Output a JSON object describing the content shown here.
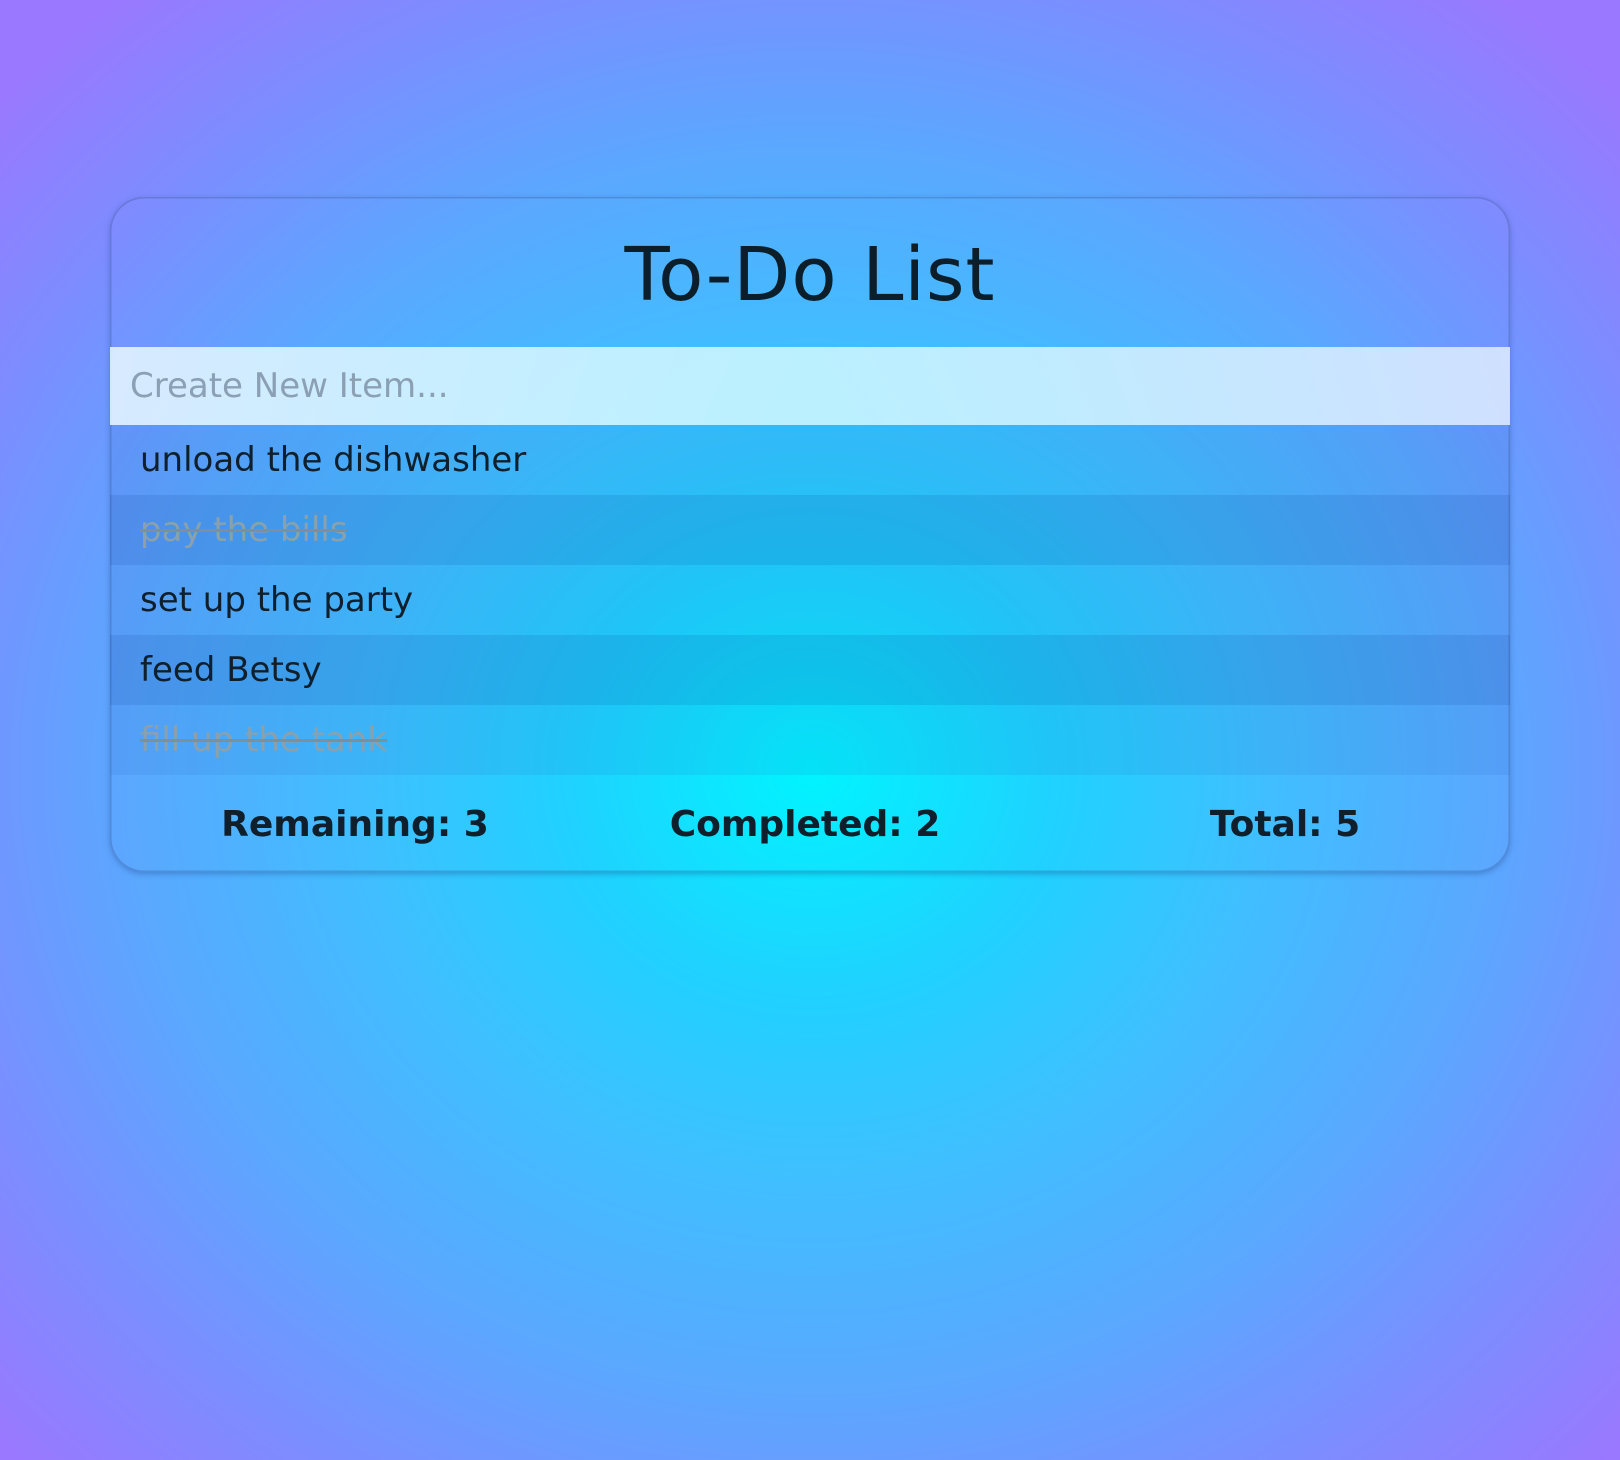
{
  "app": {
    "title": "To-Do List"
  },
  "new_item": {
    "placeholder": "Create New Item...",
    "value": ""
  },
  "items": [
    {
      "label": "unload the dishwasher",
      "completed": false
    },
    {
      "label": "pay the bills",
      "completed": true
    },
    {
      "label": "set up the party",
      "completed": false
    },
    {
      "label": "feed Betsy",
      "completed": false
    },
    {
      "label": "fill up the tank",
      "completed": true
    }
  ],
  "stats": {
    "remaining": "Remaining: 3",
    "completed": "Completed: 2",
    "total": "Total: 5"
  }
}
